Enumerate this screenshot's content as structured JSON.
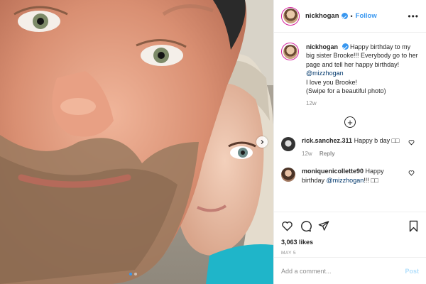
{
  "header": {
    "username": "nickhogan",
    "separator": "•",
    "follow_label": "Follow",
    "more_label": "•••"
  },
  "caption": {
    "username": "nickhogan",
    "text": "Happy birthday to my big sister Brooke!!! Everybody go to her page and tell her happy birthday!",
    "mention": "@mizzhogan",
    "line2": "I love you Brooke!",
    "line3": "(Swipe for a beautiful photo)",
    "time": "12w"
  },
  "load_more_label": "+",
  "comments": [
    {
      "username": "rick.sanchez.311",
      "text": "Happy b day □□",
      "time": "12w",
      "reply_label": "Reply"
    },
    {
      "username": "moniquenicollette90",
      "text": "Happy birthday",
      "mention": "@mizzhogan",
      "suffix": "!!! □□"
    }
  ],
  "likes": "3,063 likes",
  "date": "MAY 5",
  "comment_input": {
    "placeholder": "Add a comment..."
  },
  "post_label": "Post",
  "icons": [
    "heart-icon",
    "comment-icon",
    "share-icon",
    "bookmark-icon",
    "chevron-right-icon",
    "plus-circle-icon",
    "verified-icon"
  ],
  "colors": {
    "link": "#3897f0",
    "mention": "#00376b",
    "muted": "#8e8e8e",
    "post_disabled": "#b2dffc",
    "text": "#262626"
  }
}
